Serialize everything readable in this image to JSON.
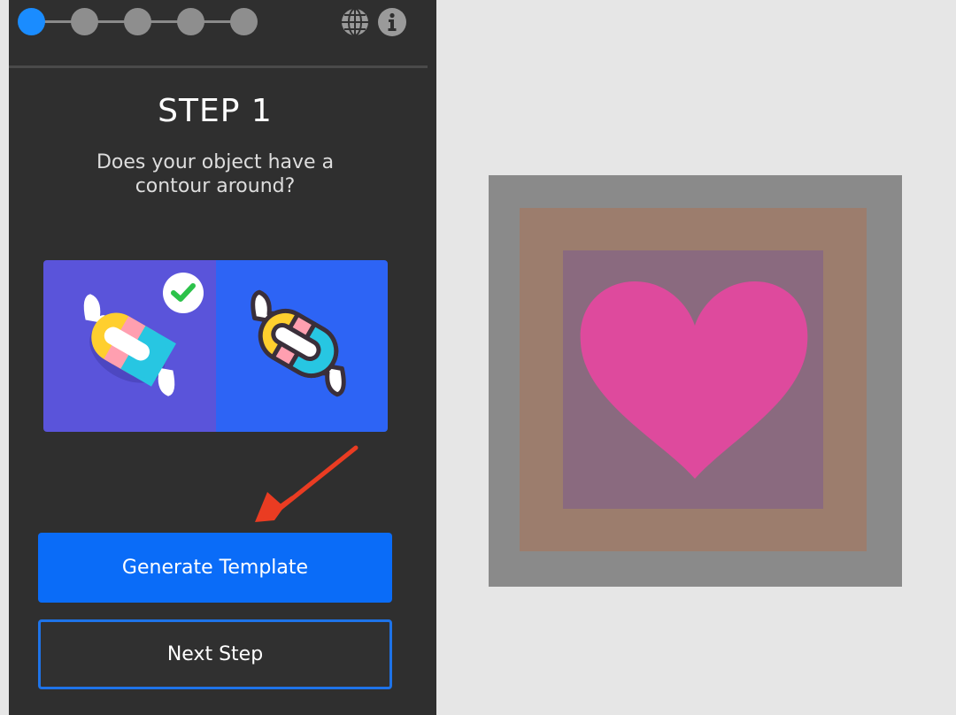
{
  "stepper": {
    "steps": [
      "1",
      "2",
      "3",
      "4",
      "5"
    ],
    "active_step": 1,
    "globe_icon": "globe-icon",
    "info_icon": "info-icon"
  },
  "step": {
    "title": "STEP 1",
    "question": "Does your object have a contour around?"
  },
  "choices": [
    {
      "id": "no-contour",
      "selected": true,
      "icon": "candy-icon"
    },
    {
      "id": "with-contour",
      "selected": false,
      "icon": "candy-outlined-icon"
    }
  ],
  "buttons": {
    "generate": "Generate Template",
    "next": "Next Step"
  },
  "colors": {
    "accent": "#1a8cff",
    "primary_button": "#0a6cf8",
    "panel_bg": "#2f2f2f",
    "heart": "#de4a9d",
    "annotation_arrow": "#ea3c22"
  },
  "preview": {
    "shape": "heart-icon"
  }
}
